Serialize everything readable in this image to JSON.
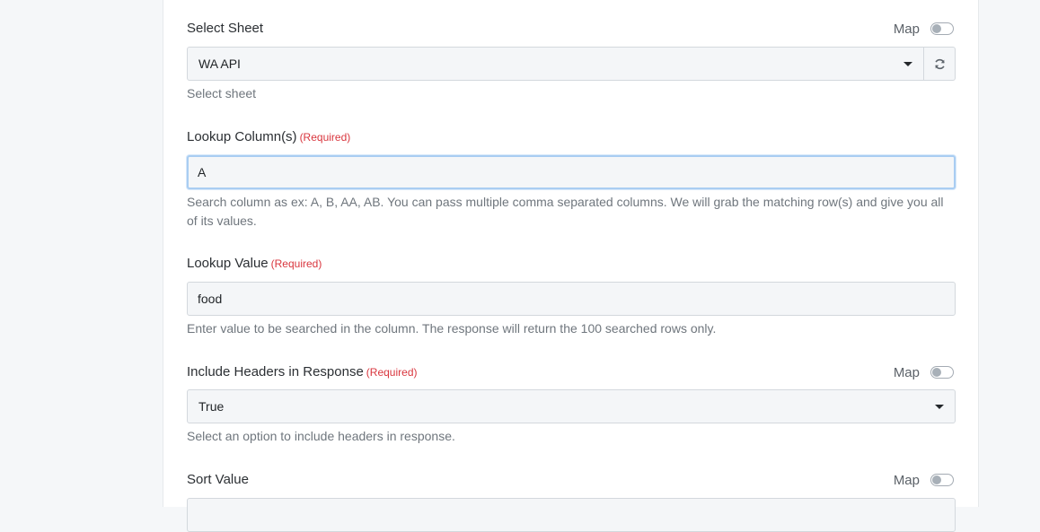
{
  "fields": {
    "select_sheet": {
      "label": "Select Sheet",
      "map_label": "Map",
      "value": "WA API",
      "help": "Select sheet"
    },
    "lookup_column": {
      "label": "Lookup Column(s)",
      "required": "(Required)",
      "value": "A",
      "help": "Search column as ex: A, B, AA, AB. You can pass multiple comma separated columns. We will grab the matching row(s) and give you all of its values."
    },
    "lookup_value": {
      "label": "Lookup Value",
      "required": "(Required)",
      "value": "food",
      "help": "Enter value to be searched in the column. The response will return the 100 searched rows only."
    },
    "include_headers": {
      "label": "Include Headers in Response",
      "required": "(Required)",
      "map_label": "Map",
      "value": "True",
      "help": "Select an option to include headers in response."
    },
    "sort_value": {
      "label": "Sort Value",
      "map_label": "Map"
    }
  },
  "icons": {
    "refresh": "refresh-icon",
    "dropdown": "chevron-down-icon"
  },
  "colors": {
    "required": "#d9363e",
    "focus_border": "#a9cdf2",
    "input_bg": "#f4f6f8"
  }
}
